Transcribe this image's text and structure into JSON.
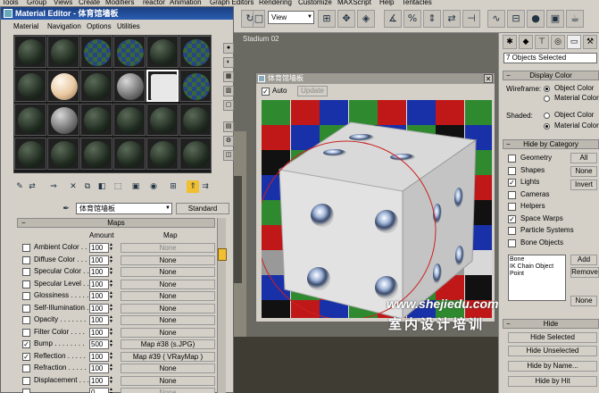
{
  "menubar": [
    "Tools",
    "Group",
    "Views",
    "Create",
    "Modifiers",
    "reactor",
    "Animation",
    "Graph Editors",
    "Rendering",
    "Customize",
    "MAXScript",
    "Help",
    "Tentacles"
  ],
  "toolbar": {
    "view_select": "View"
  },
  "viewport": {
    "label": "Stadium 02"
  },
  "material_editor": {
    "title": "Material Editor - 体育馆墙板",
    "menu": [
      "Material",
      "Navigation",
      "Options",
      "Utilities"
    ],
    "material_name": "体育馆墙板",
    "material_type": "Standard",
    "maps_title": "Maps",
    "col_amount": "Amount",
    "col_map": "Map",
    "maps": [
      {
        "label": "Ambient Color . . . .",
        "checked": false,
        "amount": "100",
        "map": "None",
        "dim": true
      },
      {
        "label": "Diffuse Color . . . .",
        "checked": false,
        "amount": "100",
        "map": "None",
        "dim": false
      },
      {
        "label": "Specular Color . .",
        "checked": false,
        "amount": "100",
        "map": "None",
        "dim": false
      },
      {
        "label": "Specular Level . .",
        "checked": false,
        "amount": "100",
        "map": "None",
        "dim": false
      },
      {
        "label": "Glossiness . . . . .",
        "checked": false,
        "amount": "100",
        "map": "None",
        "dim": false
      },
      {
        "label": "Self-Illumination . .",
        "checked": false,
        "amount": "100",
        "map": "None",
        "dim": false
      },
      {
        "label": "Opacity . . . . . . .",
        "checked": false,
        "amount": "100",
        "map": "None",
        "dim": false
      },
      {
        "label": "Filter Color . . . .",
        "checked": false,
        "amount": "100",
        "map": "None",
        "dim": false
      },
      {
        "label": "Bump . . . . . . . .",
        "checked": true,
        "amount": "500",
        "map": "Map #38 (s.JPG)",
        "dim": false
      },
      {
        "label": "Reflection . . . . .",
        "checked": true,
        "amount": "100",
        "map": "Map #39  ( VRayMap )",
        "dim": false
      },
      {
        "label": "Refraction . . . . .",
        "checked": false,
        "amount": "100",
        "map": "None",
        "dim": false
      },
      {
        "label": "Displacement . . .",
        "checked": false,
        "amount": "100",
        "map": "None",
        "dim": false
      },
      {
        "label": ". . . . . . . . . . .",
        "checked": false,
        "amount": "0",
        "map": "None",
        "dim": true
      }
    ]
  },
  "small_window": {
    "title": "体育馆墙板",
    "auto_label": "Auto",
    "update_label": "Update"
  },
  "watermark": {
    "url": "www.shejiedu.com",
    "cn": "室内设计培训"
  },
  "command_panel": {
    "selection": "7 Objects Selected",
    "display_color": "Display Color",
    "wireframe": "Wireframe:",
    "shaded": "Shaded:",
    "object_color": "Object Color",
    "material_color": "Material Color",
    "hide_by_category": "Hide by Category",
    "categories": [
      {
        "label": "Geometry",
        "checked": false
      },
      {
        "label": "Shapes",
        "checked": false
      },
      {
        "label": "Lights",
        "checked": true
      },
      {
        "label": "Cameras",
        "checked": false
      },
      {
        "label": "Helpers",
        "checked": false
      },
      {
        "label": "Space Warps",
        "checked": true
      },
      {
        "label": "Particle Systems",
        "checked": false
      },
      {
        "label": "Bone Objects",
        "checked": false
      }
    ],
    "btn_all": "All",
    "btn_none": "None",
    "btn_invert": "Invert",
    "list_items": [
      "Bone",
      "IK Chain Object",
      "Point"
    ],
    "btn_add": "Add",
    "btn_remove": "Remove",
    "btn_none2": "None",
    "hide": "Hide",
    "hide_selected": "Hide Selected",
    "hide_unselected": "Hide Unselected",
    "hide_by_name": "Hide by Name...",
    "hide_by_hit": "Hide by Hit"
  },
  "colors": {
    "title_blue": "#1a3f82",
    "bg": "#d4d0c8",
    "ring_red": "#cc2222"
  }
}
